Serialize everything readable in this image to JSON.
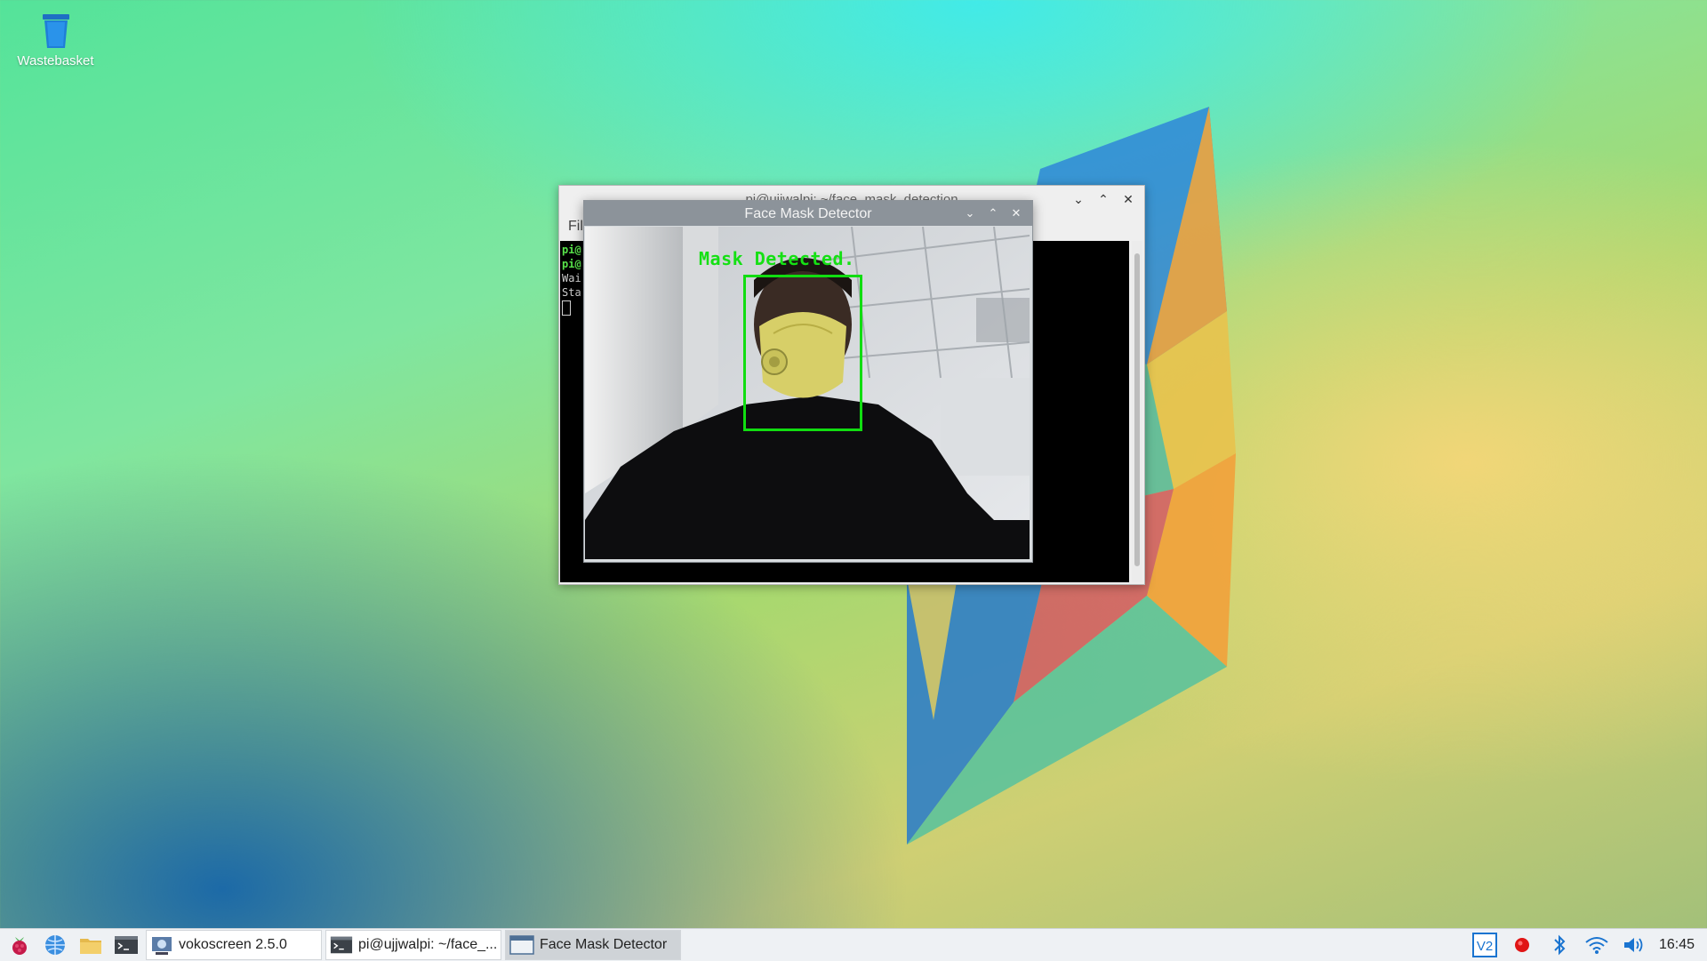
{
  "desktop": {
    "icons": [
      {
        "label": "Wastebasket",
        "icon": "trash-icon"
      }
    ]
  },
  "terminal": {
    "title": "pi@ujjwalpi: ~/face_mask_detection",
    "menu_file": "Fil",
    "lines": [
      "pi@",
      "pi@",
      "Wai",
      "Sta"
    ],
    "colors": {
      "prompt": "#58e24a",
      "text": "#cfcfcf"
    }
  },
  "detector": {
    "title": "Face Mask Detector",
    "label": "Mask Detected.",
    "box_color": "#11dd11"
  },
  "taskbar": {
    "launchers": [
      "raspberry-menu-icon",
      "web-browser-icon",
      "file-manager-icon",
      "terminal-icon"
    ],
    "tasks": [
      {
        "label": "vokoscreen 2.5.0",
        "icon": "vokoscreen-icon"
      },
      {
        "label": "pi@ujjwalpi: ~/face_...",
        "icon": "terminal-icon"
      },
      {
        "label": "Face Mask Detector",
        "icon": "window-icon"
      }
    ],
    "tray": [
      "vnc-icon",
      "record-icon",
      "bluetooth-icon",
      "wifi-icon",
      "volume-icon"
    ],
    "clock": "16:45"
  }
}
